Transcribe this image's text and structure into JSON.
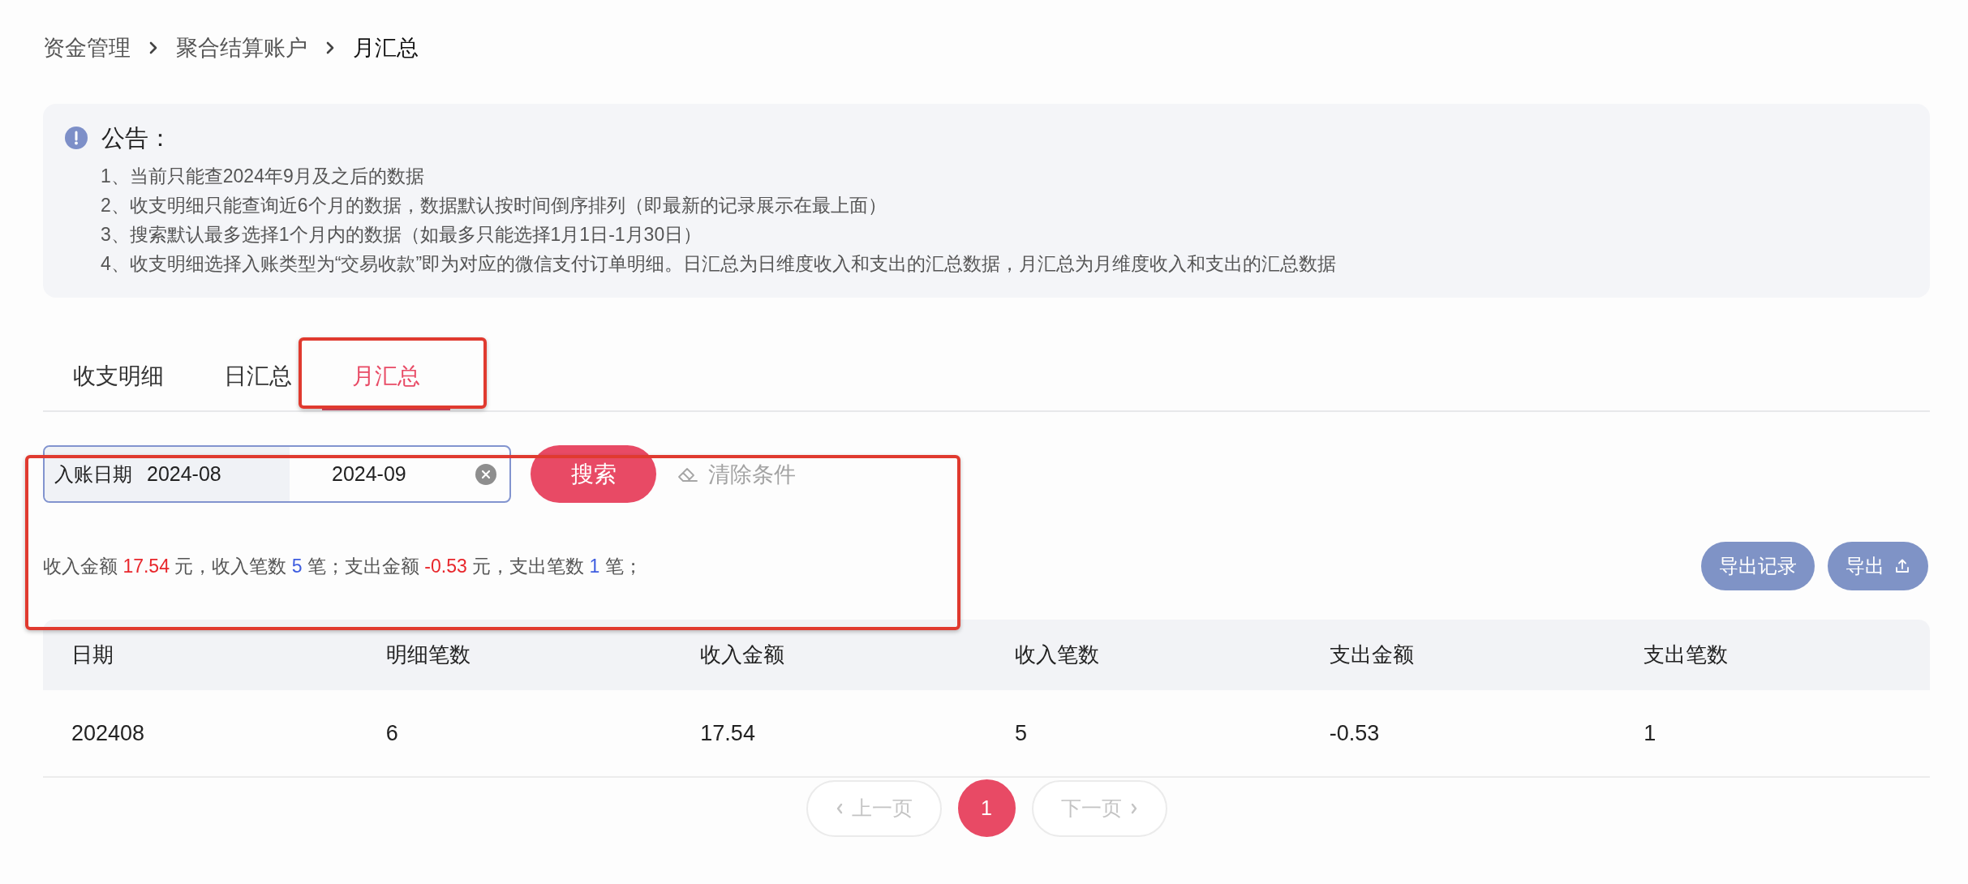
{
  "breadcrumb": [
    {
      "label": "资金管理",
      "current": false
    },
    {
      "label": "聚合结算账户",
      "current": false
    },
    {
      "label": "月汇总",
      "current": true
    }
  ],
  "notice": {
    "title": "公告：",
    "items": [
      "1、当前只能查2024年9月及之后的数据",
      "2、收支明细只能查询近6个月的数据，数据默认按时间倒序排列（即最新的记录展示在最上面）",
      "3、搜索默认最多选择1个月内的数据（如最多只能选择1月1日-1月30日）",
      "4、收支明细选择入账类型为“交易收款”即为对应的微信支付订单明细。日汇总为日维度收入和支出的汇总数据，月汇总为月维度收入和支出的汇总数据"
    ]
  },
  "tabs": [
    {
      "label": "收支明细",
      "selected": false
    },
    {
      "label": "日汇总",
      "selected": false
    },
    {
      "label": "月汇总",
      "selected": true
    }
  ],
  "filter": {
    "date_range": {
      "label": "入账日期",
      "start": "2024-08",
      "end": "2024-09"
    },
    "search_button": "搜索",
    "clear_button": "清除条件"
  },
  "summary": [
    {
      "kind": "label",
      "text": "收入金额"
    },
    {
      "kind": "amount",
      "text": "17.54"
    },
    {
      "kind": "label",
      "text": "元，收入笔数"
    },
    {
      "kind": "count",
      "text": "5"
    },
    {
      "kind": "label",
      "text": "笔；支出金额"
    },
    {
      "kind": "amount",
      "text": "-0.53"
    },
    {
      "kind": "label",
      "text": "元，支出笔数"
    },
    {
      "kind": "count",
      "text": "1"
    },
    {
      "kind": "label",
      "text": "笔；"
    }
  ],
  "export_buttons": [
    {
      "kind": "plain",
      "label": "导出记录"
    },
    {
      "kind": "upload",
      "label": "导出"
    }
  ],
  "table": {
    "columns": [
      "日期",
      "明细笔数",
      "收入金额",
      "收入笔数",
      "支出金额",
      "支出笔数"
    ],
    "rows": [
      [
        "202408",
        "6",
        "17.54",
        "5",
        "-0.53",
        "1"
      ]
    ]
  },
  "pagination": {
    "prev": {
      "label": "上一页",
      "disabled": true
    },
    "pages": [
      {
        "label": "1",
        "selected": true
      }
    ],
    "next": {
      "label": "下一页",
      "disabled": true
    }
  }
}
